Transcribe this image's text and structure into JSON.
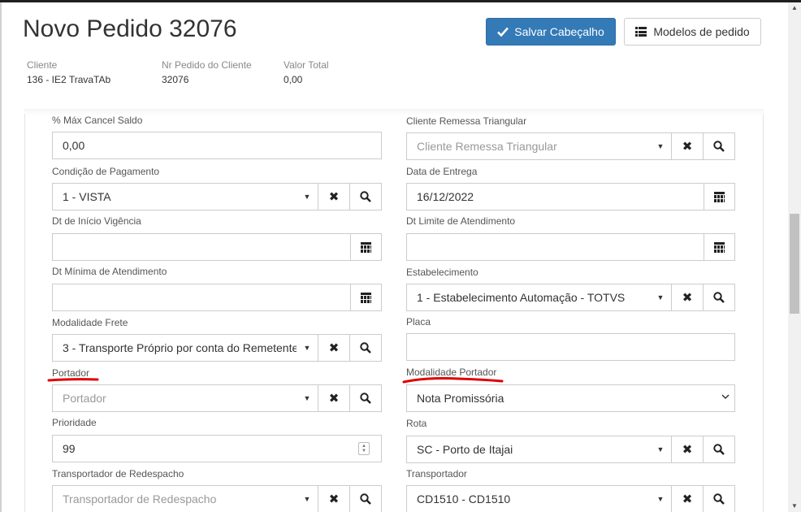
{
  "header": {
    "title": "Novo Pedido 32076",
    "save_label": "Salvar Cabeçalho",
    "models_label": "Modelos de pedido"
  },
  "summary": {
    "client_label": "Cliente",
    "client_value": "136 - IE2 TravaTAb",
    "order_number_label": "Nr Pedido do Cliente",
    "order_number_value": "32076",
    "total_label": "Valor Total",
    "total_value": "0,00"
  },
  "form": {
    "max_cancel": {
      "label": "% Máx Cancel Saldo",
      "value": "0,00"
    },
    "payment_condition": {
      "label": "Condição de Pagamento",
      "value": "1 - VISTA"
    },
    "validity_start": {
      "label": "Dt de Início Vigência",
      "value": ""
    },
    "min_service_date": {
      "label": "Dt Mínima de Atendimento",
      "value": ""
    },
    "freight_mode": {
      "label": "Modalidade Frete",
      "value": "3 - Transporte Próprio por conta do Remetente"
    },
    "carrier": {
      "label": "Portador",
      "placeholder": "Portador"
    },
    "priority": {
      "label": "Prioridade",
      "value": "99"
    },
    "redispatch_carrier": {
      "label": "Transportador de Redespacho",
      "placeholder": "Transportador de Redespacho"
    },
    "triangular_client": {
      "label": "Cliente Remessa Triangular",
      "placeholder": "Cliente Remessa Triangular"
    },
    "delivery_date": {
      "label": "Data de Entrega",
      "value": "16/12/2022"
    },
    "service_limit_date": {
      "label": "Dt Limite de Atendimento",
      "value": ""
    },
    "establishment": {
      "label": "Estabelecimento",
      "value": "1 - Estabelecimento Automação - TOTVS"
    },
    "plate": {
      "label": "Placa",
      "value": ""
    },
    "carrier_mode": {
      "label": "Modalidade Portador",
      "value": "Nota Promissória"
    },
    "route": {
      "label": "Rota",
      "value": "SC - Porto de Itajai"
    },
    "transporter": {
      "label": "Transportador",
      "value": "CD1510 - CD1510"
    }
  },
  "colors": {
    "primary": "#337ab7",
    "annotation": "#e00000"
  },
  "icons": {
    "save": "check-icon",
    "models": "list-icon",
    "clear": "times-icon",
    "search": "search-icon",
    "calendar": "calendar-icon",
    "dropdown": "caret-down-icon"
  }
}
